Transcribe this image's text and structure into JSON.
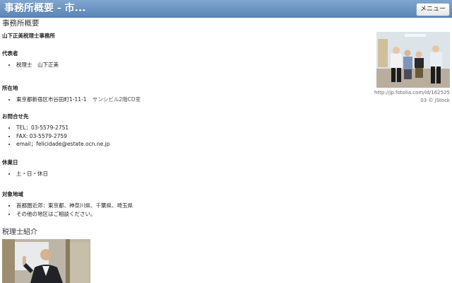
{
  "header": {
    "title": "事務所概要 - 市...",
    "menu_label": "メニュー"
  },
  "page": {
    "heading": "事務所概要",
    "office_name": "山下正美税理士事務所"
  },
  "sections": {
    "representative": {
      "title": "代表者",
      "items": [
        "税理士　山下正美"
      ]
    },
    "address": {
      "title": "所在地",
      "line": "東京都新宿区市谷田町1-11-1",
      "building": "サンシビル2階CD室"
    },
    "contact": {
      "title": "お問合せ先",
      "tel": "TEL：03-5579-2751",
      "fax": "FAX: 03-5579-2759",
      "email": "email；felicidade@estate.ocn.ne.jp"
    },
    "holidays": {
      "title": "休業日",
      "items": [
        "土・日・休日"
      ]
    },
    "area": {
      "title": "対象地域",
      "items": [
        "首都圏近郊：東京都、神奈川県、千葉県、埼玉県",
        "その他の地区はご相談ください。"
      ]
    }
  },
  "photo_credit": {
    "url": "http://jp.fotolia.com/id/162525",
    "suffix": "03 © jStock"
  },
  "accountant_section": {
    "title": "税理士紹介"
  }
}
